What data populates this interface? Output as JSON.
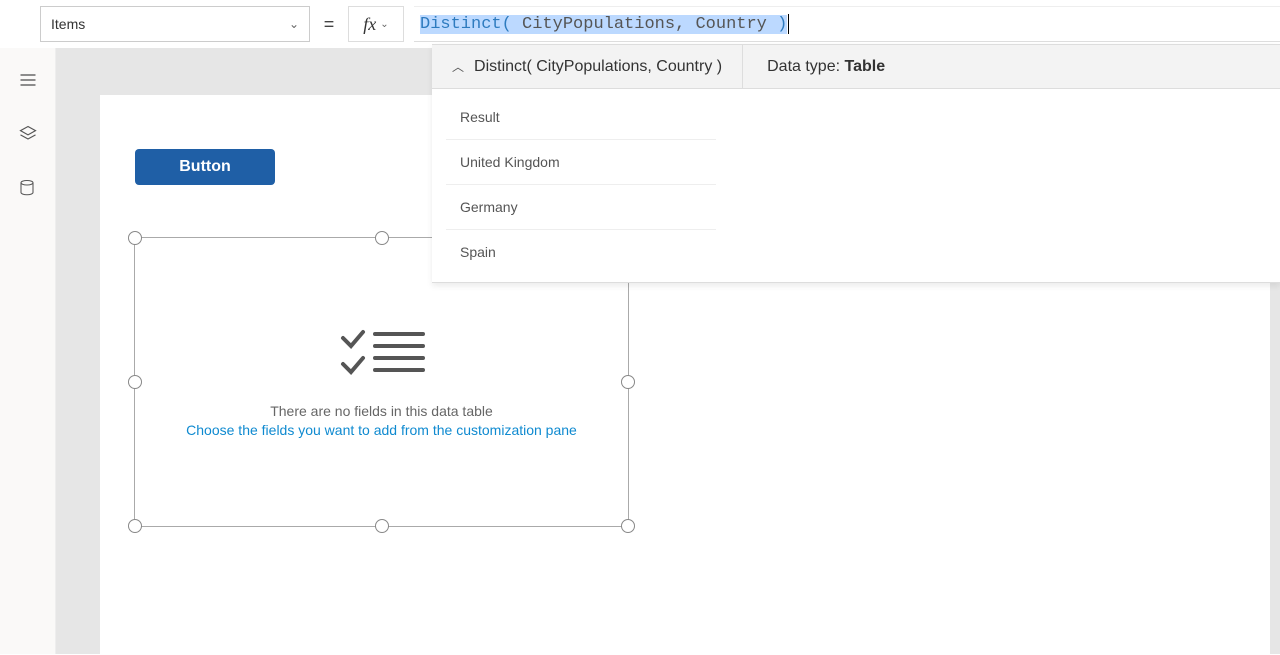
{
  "property_selector": {
    "value": "Items"
  },
  "formula": {
    "func": "Distinct",
    "arg1": "CityPopulations",
    "arg2": "Country",
    "display_header": "Distinct( CityPopulations, Country )"
  },
  "datatype": {
    "label": "Data type:",
    "value": "Table"
  },
  "result": {
    "header": "Result",
    "rows": [
      "United Kingdom",
      "Germany",
      "Spain"
    ]
  },
  "canvas": {
    "button_label": "Button",
    "dt_msg1": "There are no fields in this data table",
    "dt_msg2": "Choose the fields you want to add from the customization pane"
  },
  "fx_label": "fx"
}
